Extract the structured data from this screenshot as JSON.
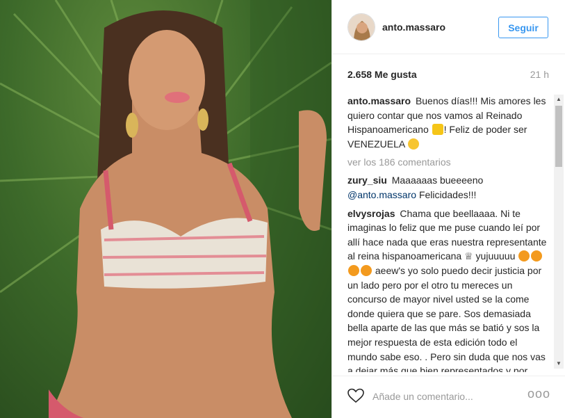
{
  "post": {
    "username": "anto.massaro",
    "follow_label": "Seguir",
    "likes": "2.658 Me gusta",
    "time": "21 h",
    "view_all": "ver los 186 comentarios",
    "add_comment_placeholder": "Añade un comentario...",
    "more_options": "ooo"
  },
  "caption": {
    "author": "anto.massaro",
    "text_1": "Buenos días!!! Mis amores les quiero contar que nos vamos al Reinado Hispanoamericano",
    "text_2": "! Feliz de poder ser VENEZUELA"
  },
  "comments": [
    {
      "author": "zury_siu",
      "text": "Maaaaaas bueeeeno",
      "mention": "@anto.massaro",
      "text_after": "Felicidades!!!"
    },
    {
      "author": "elvysrojas",
      "text_1": "Chama que beellaaaa. Ni te imaginas lo feliz que me puse cuando leí por allí hace nada que eras nuestra representante al reina hispanoamericana",
      "text_2": "♕ yujuuuuu",
      "text_3": "aeew's yo solo puedo decir justicia por un lado pero por el otro tu mereces un concurso de mayor nivel usted se la come donde quiera que se pare. Sos demasiada bella aparte de las que más se batió y sos la mejor respuesta de esta edición todo el mundo sabe eso. . Pero sin duda que nos vas a dejar más que bien representados y por todo lo alto. Dignamente venezolana"
    }
  ],
  "colors": {
    "accent": "#3897f0",
    "text": "#262626",
    "muted": "#999999",
    "border": "#efefef"
  }
}
